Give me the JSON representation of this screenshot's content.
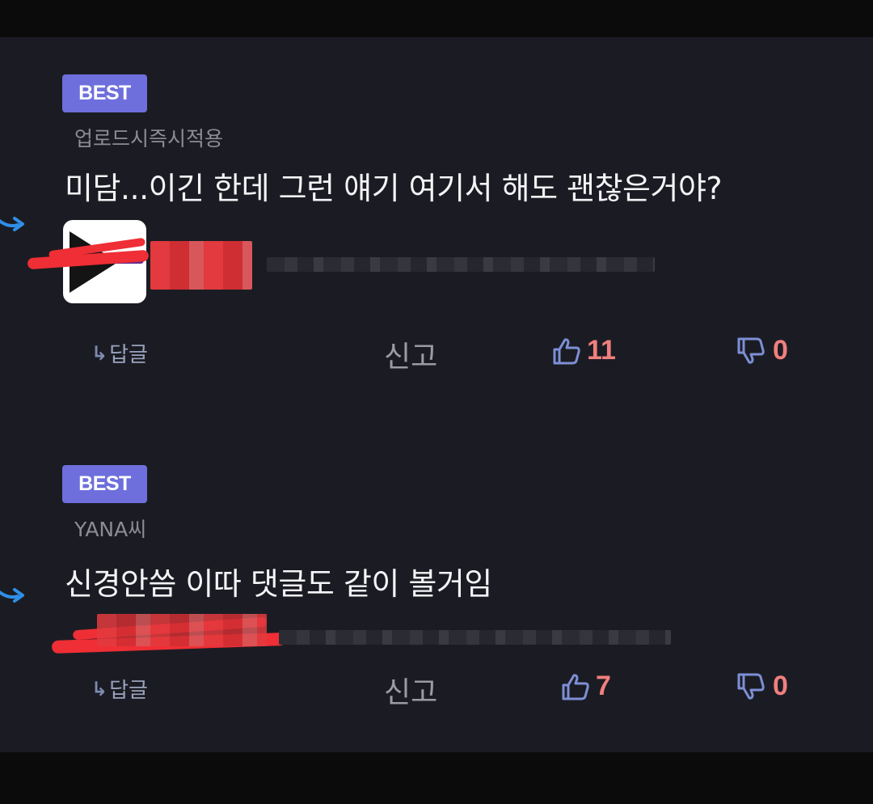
{
  "comments": [
    {
      "badge": "BEST",
      "nickname": "업로드시즉시적용",
      "text": "미담...이긴 한데 그런 얘기 여기서 해도 괜찮은거야?",
      "reply_label": "답글",
      "report_label": "신고",
      "likes": "11",
      "dislikes": "0"
    },
    {
      "badge": "BEST",
      "nickname": "YANA씨",
      "text": "신경안씀 이따 댓글도 같이 볼거임",
      "reply_label": "답글",
      "report_label": "신고",
      "likes": "7",
      "dislikes": "0"
    }
  ],
  "icons": {
    "reply": "reply-arrow-icon",
    "like": "thumbs-up-icon",
    "dislike": "thumbs-down-icon",
    "side_arrow": "curved-arrow-icon"
  },
  "colors": {
    "background": "#1b1c23",
    "badge": "#6e6fdc",
    "count": "#f07f7e",
    "thumb_icon": "#7d8fd6",
    "redaction": "#ef2e35"
  }
}
